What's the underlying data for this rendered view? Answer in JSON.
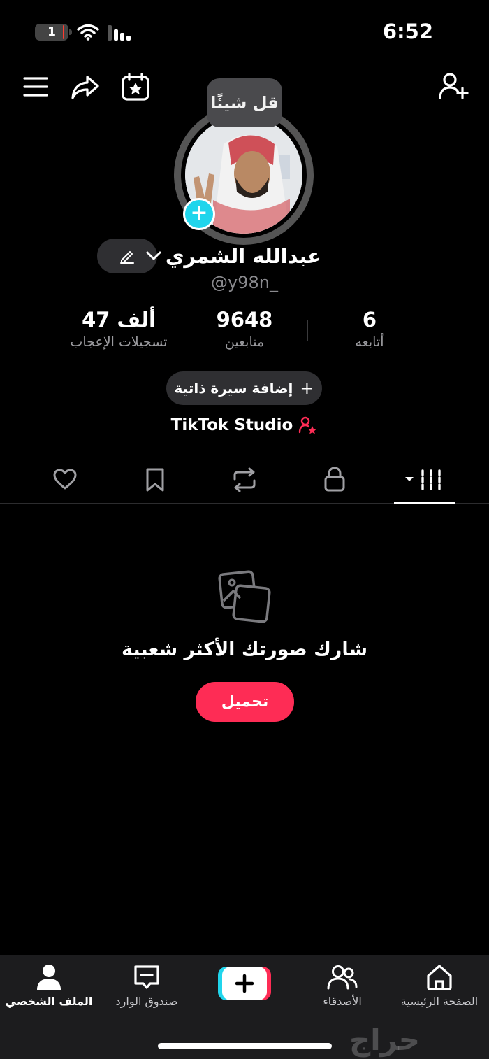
{
  "status": {
    "battery": "1",
    "time": "6:52"
  },
  "profile": {
    "say_something": "قل شيئًا",
    "name": "عبدالله الشمري",
    "handle": "@y98n_"
  },
  "stats": [
    {
      "value": "47 ألف",
      "label": "تسجيلات الإعجاب"
    },
    {
      "value": "9648",
      "label": "متابعين"
    },
    {
      "value": "6",
      "label": "أتابعه"
    }
  ],
  "bio_button": "إضافة سيرة ذاتية",
  "studio_label": "TikTok Studio",
  "tabs": [
    "liked",
    "favorites",
    "reposts",
    "private",
    "videos"
  ],
  "empty_state": {
    "title": "شارك صورتك الأكثر شعبية",
    "button": "تحميل"
  },
  "nav": {
    "home": "الصفحة الرئيسية",
    "friends": "الأصدقاء",
    "inbox": "صندوق الوارد",
    "profile": "الملف الشخصي"
  },
  "watermark": "حراج",
  "colors": {
    "accent": "#fe2c55",
    "cyan": "#20d5ec",
    "background": "#000000"
  }
}
